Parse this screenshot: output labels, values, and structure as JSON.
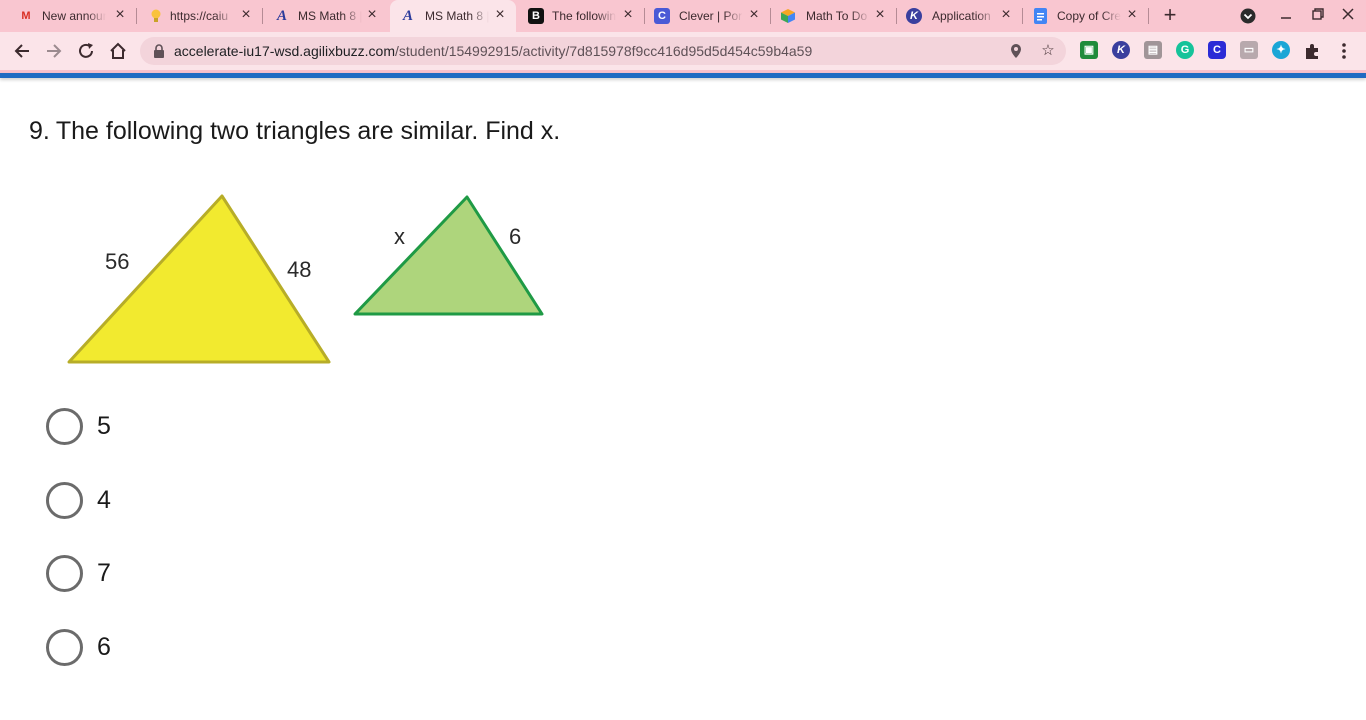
{
  "browser": {
    "tabs": [
      {
        "title": "New announ",
        "icon": "gmail-icon",
        "active": false
      },
      {
        "title": "https://caiu",
        "icon": "lightbulb-icon",
        "active": false
      },
      {
        "title": "MS Math 8 |",
        "icon": "agilix-icon",
        "active": false
      },
      {
        "title": "MS Math 8 |",
        "icon": "agilix-icon",
        "active": true
      },
      {
        "title": "The followin",
        "icon": "brainly-icon",
        "active": false
      },
      {
        "title": "Clever | Por",
        "icon": "clever-icon",
        "active": false
      },
      {
        "title": "Math To Do",
        "icon": "cube-icon",
        "active": false
      },
      {
        "title": "Application",
        "icon": "k-icon",
        "active": false
      },
      {
        "title": "Copy of Cre",
        "icon": "docs-icon",
        "active": false
      }
    ],
    "url_domain": "accelerate-iu17-wsd.agilixbuzz.com",
    "url_path": "/student/154992915/activity/7d815978f9cc416d95d5d454c59b4a59"
  },
  "question": {
    "number": "9.",
    "text": "The following two triangles are similar. Find x."
  },
  "figure": {
    "large_triangle": {
      "left_side": "56",
      "right_side": "48",
      "fill": "#f2ea2f",
      "stroke": "#b7ad28"
    },
    "small_triangle": {
      "left_side": "x",
      "right_side": "6",
      "fill": "#aed57c",
      "stroke": "#1f9a45"
    }
  },
  "options": [
    {
      "label": "5"
    },
    {
      "label": "4"
    },
    {
      "label": "7"
    },
    {
      "label": "6"
    }
  ],
  "colors": {
    "tab_strip": "#f9c6d0",
    "toolbar": "#fbe4e9",
    "accent_bar": "#1f6bc2"
  }
}
